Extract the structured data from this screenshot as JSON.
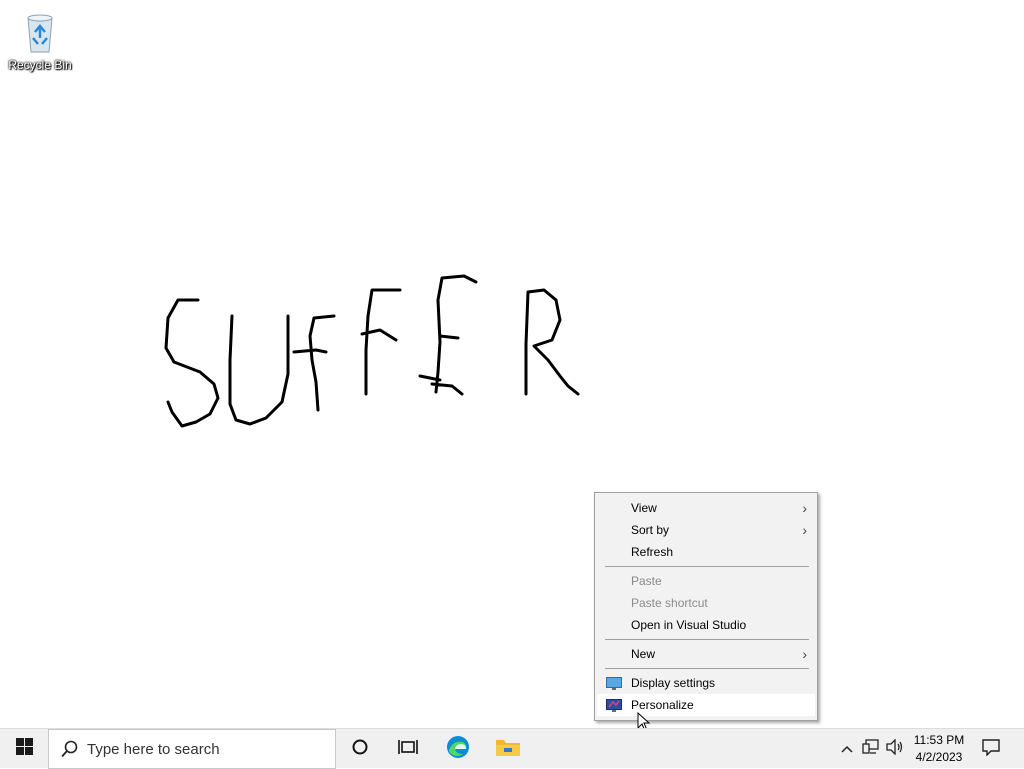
{
  "desktop": {
    "icons": [
      {
        "label": "Recycle Bin",
        "icon": "recycle-bin-icon"
      }
    ],
    "drawing_text": "SUFFER"
  },
  "context_menu": {
    "items": [
      {
        "label": "View",
        "submenu": true,
        "enabled": true
      },
      {
        "label": "Sort by",
        "submenu": true,
        "enabled": true
      },
      {
        "label": "Refresh",
        "submenu": false,
        "enabled": true
      },
      {
        "label": "Paste",
        "submenu": false,
        "enabled": false
      },
      {
        "label": "Paste shortcut",
        "submenu": false,
        "enabled": false
      },
      {
        "label": "Open in Visual Studio",
        "submenu": false,
        "enabled": true
      },
      {
        "label": "New",
        "submenu": true,
        "enabled": true
      },
      {
        "label": "Display settings",
        "submenu": false,
        "enabled": true,
        "icon": "display-settings-icon"
      },
      {
        "label": "Personalize",
        "submenu": false,
        "enabled": true,
        "icon": "personalize-icon",
        "highlighted": true
      }
    ],
    "arrow_glyph": "›"
  },
  "taskbar": {
    "search_placeholder": "Type here to search",
    "clock_time": "11:53 PM",
    "clock_date": "4/2/2023",
    "colors": {
      "windows_logo": "#1a1a1a",
      "edge_primary": "#0c8bd6",
      "edge_secondary": "#4cd964",
      "explorer_folder": "#f2b928"
    }
  }
}
